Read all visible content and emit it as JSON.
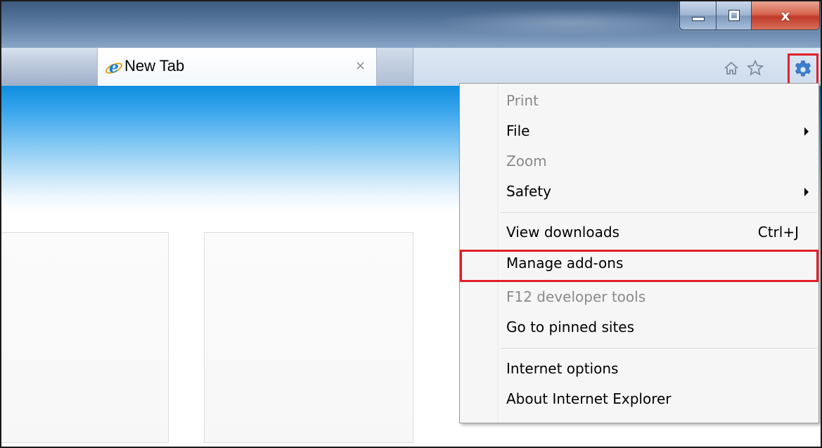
{
  "window": {
    "controls": {
      "minimize_icon": "minimize-icon",
      "maximize_icon": "maximize-icon",
      "close_icon": "close-icon",
      "close_glyph": "x"
    }
  },
  "tabs": [
    {
      "label": "New Tab",
      "icon": "ie-logo-icon",
      "close_glyph": "×",
      "active": true
    }
  ],
  "toolbar": {
    "icons": [
      "home-icon",
      "favorites-star-icon",
      "tools-gear-icon"
    ],
    "highlight_color": "#e0202a"
  },
  "menu": {
    "items": [
      {
        "label": "Print",
        "disabled": true,
        "submenu": false,
        "shortcut": ""
      },
      {
        "label": "File",
        "disabled": false,
        "submenu": true,
        "shortcut": ""
      },
      {
        "label": "Zoom",
        "disabled": true,
        "submenu": false,
        "shortcut": ""
      },
      {
        "label": "Safety",
        "disabled": false,
        "submenu": true,
        "shortcut": ""
      },
      {
        "label": "View downloads",
        "disabled": false,
        "submenu": false,
        "shortcut": "Ctrl+J"
      },
      {
        "label": "Manage add-ons",
        "disabled": false,
        "submenu": false,
        "shortcut": "",
        "highlighted": true
      },
      {
        "label": "F12 developer tools",
        "disabled": true,
        "submenu": false,
        "shortcut": ""
      },
      {
        "label": "Go to pinned sites",
        "disabled": false,
        "submenu": false,
        "shortcut": ""
      },
      {
        "label": "Internet options",
        "disabled": false,
        "submenu": false,
        "shortcut": ""
      },
      {
        "label": "About Internet Explorer",
        "disabled": false,
        "submenu": false,
        "shortcut": ""
      }
    ]
  },
  "colors": {
    "accent_blue": "#1e90e6",
    "highlight_red": "#e0202a",
    "disabled_text": "#8a8a8a"
  }
}
